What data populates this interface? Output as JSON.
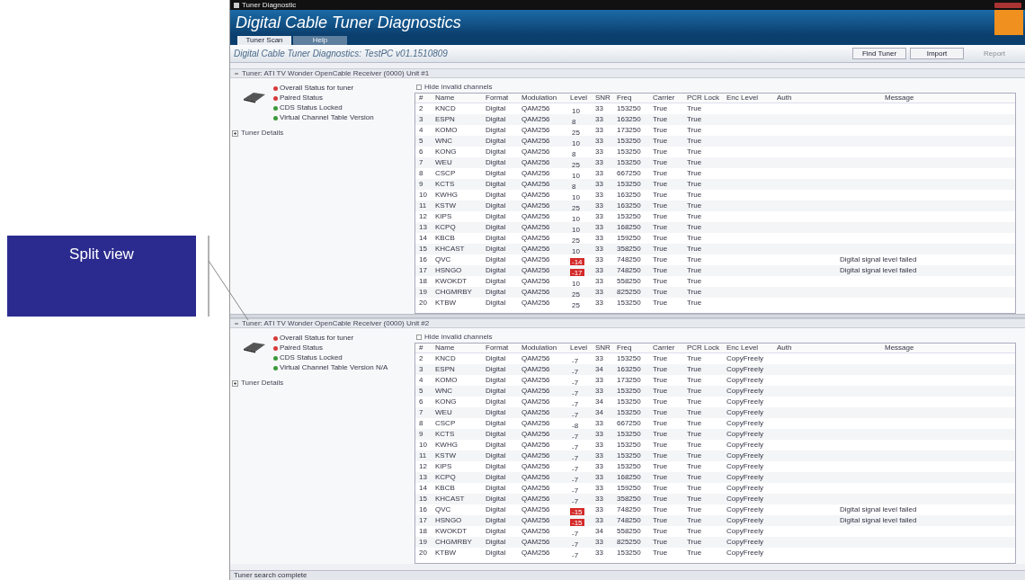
{
  "callout": {
    "label": "Split view"
  },
  "window": {
    "title": "Tuner Diagnostic"
  },
  "header": {
    "title": "Digital Cable Tuner Diagnostics"
  },
  "tabs": [
    {
      "label": "Tuner Scan",
      "selected": true
    },
    {
      "label": "Help",
      "selected": false
    }
  ],
  "toolbar": {
    "title": "Digital Cable Tuner Diagnostics: TestPC v01.1510809",
    "buttons": [
      {
        "label": "Find Tuner",
        "disabled": false
      },
      {
        "label": "Import",
        "disabled": false
      },
      {
        "label": "Report",
        "disabled": true
      }
    ]
  },
  "panels": [
    {
      "header": "Tuner: ATI TV Wonder OpenCable Receiver (0000) Unit #1",
      "expanded": true,
      "statuses": [
        {
          "label": "Overall Status for tuner",
          "color": "#d63a3a"
        },
        {
          "label": "Paired Status",
          "color": "#d63a3a"
        },
        {
          "label": "CDS Status Locked",
          "color": "#3a9a3a"
        },
        {
          "label": "Virtual Channel Table Version",
          "color": "#3a9a3a"
        }
      ],
      "details": {
        "label": "Tuner Details",
        "expanded": false
      },
      "hide_invalid": {
        "label": "Hide invalid channels",
        "checked": false
      },
      "columns": [
        "#",
        "Name",
        "Format",
        "Modulation",
        "Level",
        "SNR",
        "Freq",
        "Carrier",
        "PCR Lock",
        "Enc Level",
        "Auth",
        "Message"
      ],
      "rows": [
        {
          "num": "2",
          "name": "KNCD",
          "format": "Digital",
          "modulation": "QAM256",
          "level": "10",
          "level_alert": false,
          "snr": "33",
          "freq": "153250",
          "carrier": "True",
          "pcr_lock": "True"
        },
        {
          "num": "3",
          "name": "ESPN",
          "format": "Digital",
          "modulation": "QAM256",
          "level": "8",
          "level_alert": false,
          "snr": "33",
          "freq": "163250",
          "carrier": "True",
          "pcr_lock": "True"
        },
        {
          "num": "4",
          "name": "KOMO",
          "format": "Digital",
          "modulation": "QAM256",
          "level": "25",
          "level_alert": false,
          "snr": "33",
          "freq": "173250",
          "carrier": "True",
          "pcr_lock": "True"
        },
        {
          "num": "5",
          "name": "WNC",
          "format": "Digital",
          "modulation": "QAM256",
          "level": "10",
          "level_alert": false,
          "snr": "33",
          "freq": "153250",
          "carrier": "True",
          "pcr_lock": "True"
        },
        {
          "num": "6",
          "name": "KONG",
          "format": "Digital",
          "modulation": "QAM256",
          "level": "8",
          "level_alert": false,
          "snr": "33",
          "freq": "153250",
          "carrier": "True",
          "pcr_lock": "True"
        },
        {
          "num": "7",
          "name": "WEU",
          "format": "Digital",
          "modulation": "QAM256",
          "level": "25",
          "level_alert": false,
          "snr": "33",
          "freq": "153250",
          "carrier": "True",
          "pcr_lock": "True"
        },
        {
          "num": "8",
          "name": "CSCP",
          "format": "Digital",
          "modulation": "QAM256",
          "level": "10",
          "level_alert": false,
          "snr": "33",
          "freq": "667250",
          "carrier": "True",
          "pcr_lock": "True"
        },
        {
          "num": "9",
          "name": "KCTS",
          "format": "Digital",
          "modulation": "QAM256",
          "level": "8",
          "level_alert": false,
          "snr": "33",
          "freq": "153250",
          "carrier": "True",
          "pcr_lock": "True"
        },
        {
          "num": "10",
          "name": "KWHG",
          "format": "Digital",
          "modulation": "QAM256",
          "level": "10",
          "level_alert": false,
          "snr": "33",
          "freq": "163250",
          "carrier": "True",
          "pcr_lock": "True"
        },
        {
          "num": "11",
          "name": "KSTW",
          "format": "Digital",
          "modulation": "QAM256",
          "level": "25",
          "level_alert": false,
          "snr": "33",
          "freq": "163250",
          "carrier": "True",
          "pcr_lock": "True"
        },
        {
          "num": "12",
          "name": "KIPS",
          "format": "Digital",
          "modulation": "QAM256",
          "level": "10",
          "level_alert": false,
          "snr": "33",
          "freq": "153250",
          "carrier": "True",
          "pcr_lock": "True"
        },
        {
          "num": "13",
          "name": "KCPQ",
          "format": "Digital",
          "modulation": "QAM256",
          "level": "10",
          "level_alert": false,
          "snr": "33",
          "freq": "168250",
          "carrier": "True",
          "pcr_lock": "True"
        },
        {
          "num": "14",
          "name": "KBCB",
          "format": "Digital",
          "modulation": "QAM256",
          "level": "25",
          "level_alert": false,
          "snr": "33",
          "freq": "159250",
          "carrier": "True",
          "pcr_lock": "True"
        },
        {
          "num": "15",
          "name": "KHCAST",
          "format": "Digital",
          "modulation": "QAM256",
          "level": "10",
          "level_alert": false,
          "snr": "33",
          "freq": "358250",
          "carrier": "True",
          "pcr_lock": "True"
        },
        {
          "num": "16",
          "name": "QVC",
          "format": "Digital",
          "modulation": "QAM256",
          "level": "-14",
          "level_alert": true,
          "snr": "33",
          "freq": "748250",
          "carrier": "True",
          "pcr_lock": "True",
          "message": "Digital signal level failed"
        },
        {
          "num": "17",
          "name": "HSNGO",
          "format": "Digital",
          "modulation": "QAM256",
          "level": "-17",
          "level_alert": true,
          "snr": "33",
          "freq": "748250",
          "carrier": "True",
          "pcr_lock": "True",
          "message": "Digital signal level failed"
        },
        {
          "num": "18",
          "name": "KWOKDT",
          "format": "Digital",
          "modulation": "QAM256",
          "level": "10",
          "level_alert": false,
          "snr": "33",
          "freq": "558250",
          "carrier": "True",
          "pcr_lock": "True"
        },
        {
          "num": "19",
          "name": "CHGMRBY",
          "format": "Digital",
          "modulation": "QAM256",
          "level": "25",
          "level_alert": false,
          "snr": "33",
          "freq": "825250",
          "carrier": "True",
          "pcr_lock": "True"
        },
        {
          "num": "20",
          "name": "KTBW",
          "format": "Digital",
          "modulation": "QAM256",
          "level": "25",
          "level_alert": false,
          "snr": "33",
          "freq": "153250",
          "carrier": "True",
          "pcr_lock": "True"
        }
      ]
    },
    {
      "header": "Tuner: ATI TV Wonder OpenCable Receiver (0000) Unit #2",
      "expanded": true,
      "statuses": [
        {
          "label": "Overall Status for tuner",
          "color": "#d63a3a"
        },
        {
          "label": "Paired Status",
          "color": "#d63a3a"
        },
        {
          "label": "CDS Status Locked",
          "color": "#3a9a3a"
        },
        {
          "label": "Virtual Channel Table Version N/A",
          "color": "#3a9a3a"
        }
      ],
      "details": {
        "label": "Tuner Details",
        "expanded": false
      },
      "hide_invalid": {
        "label": "Hide invalid channels",
        "checked": false
      },
      "columns": [
        "#",
        "Name",
        "Format",
        "Modulation",
        "Level",
        "SNR",
        "Freq",
        "Carrier",
        "PCR Lock",
        "Enc Level",
        "Auth",
        "Message"
      ],
      "rows": [
        {
          "num": "2",
          "name": "KNCD",
          "format": "Digital",
          "modulation": "QAM256",
          "level": "-7",
          "level_alert": false,
          "snr": "33",
          "freq": "153250",
          "carrier": "True",
          "pcr_lock": "True",
          "enc_level": "CopyFreely"
        },
        {
          "num": "3",
          "name": "ESPN",
          "format": "Digital",
          "modulation": "QAM256",
          "level": "-7",
          "level_alert": false,
          "snr": "34",
          "freq": "163250",
          "carrier": "True",
          "pcr_lock": "True",
          "enc_level": "CopyFreely"
        },
        {
          "num": "4",
          "name": "KOMO",
          "format": "Digital",
          "modulation": "QAM256",
          "level": "-7",
          "level_alert": false,
          "snr": "33",
          "freq": "173250",
          "carrier": "True",
          "pcr_lock": "True",
          "enc_level": "CopyFreely"
        },
        {
          "num": "5",
          "name": "WNC",
          "format": "Digital",
          "modulation": "QAM256",
          "level": "-7",
          "level_alert": false,
          "snr": "33",
          "freq": "153250",
          "carrier": "True",
          "pcr_lock": "True",
          "enc_level": "CopyFreely"
        },
        {
          "num": "6",
          "name": "KONG",
          "format": "Digital",
          "modulation": "QAM256",
          "level": "-7",
          "level_alert": false,
          "snr": "34",
          "freq": "153250",
          "carrier": "True",
          "pcr_lock": "True",
          "enc_level": "CopyFreely"
        },
        {
          "num": "7",
          "name": "WEU",
          "format": "Digital",
          "modulation": "QAM256",
          "level": "-7",
          "level_alert": false,
          "snr": "34",
          "freq": "153250",
          "carrier": "True",
          "pcr_lock": "True",
          "enc_level": "CopyFreely"
        },
        {
          "num": "8",
          "name": "CSCP",
          "format": "Digital",
          "modulation": "QAM256",
          "level": "-8",
          "level_alert": false,
          "snr": "33",
          "freq": "667250",
          "carrier": "True",
          "pcr_lock": "True",
          "enc_level": "CopyFreely"
        },
        {
          "num": "9",
          "name": "KCTS",
          "format": "Digital",
          "modulation": "QAM256",
          "level": "-7",
          "level_alert": false,
          "snr": "33",
          "freq": "153250",
          "carrier": "True",
          "pcr_lock": "True",
          "enc_level": "CopyFreely"
        },
        {
          "num": "10",
          "name": "KWHG",
          "format": "Digital",
          "modulation": "QAM256",
          "level": "-7",
          "level_alert": false,
          "snr": "33",
          "freq": "153250",
          "carrier": "True",
          "pcr_lock": "True",
          "enc_level": "CopyFreely"
        },
        {
          "num": "11",
          "name": "KSTW",
          "format": "Digital",
          "modulation": "QAM256",
          "level": "-7",
          "level_alert": false,
          "snr": "33",
          "freq": "153250",
          "carrier": "True",
          "pcr_lock": "True",
          "enc_level": "CopyFreely"
        },
        {
          "num": "12",
          "name": "KIPS",
          "format": "Digital",
          "modulation": "QAM256",
          "level": "-7",
          "level_alert": false,
          "snr": "33",
          "freq": "153250",
          "carrier": "True",
          "pcr_lock": "True",
          "enc_level": "CopyFreely"
        },
        {
          "num": "13",
          "name": "KCPQ",
          "format": "Digital",
          "modulation": "QAM256",
          "level": "-7",
          "level_alert": false,
          "snr": "33",
          "freq": "168250",
          "carrier": "True",
          "pcr_lock": "True",
          "enc_level": "CopyFreely"
        },
        {
          "num": "14",
          "name": "KBCB",
          "format": "Digital",
          "modulation": "QAM256",
          "level": "-7",
          "level_alert": false,
          "snr": "33",
          "freq": "159250",
          "carrier": "True",
          "pcr_lock": "True",
          "enc_level": "CopyFreely"
        },
        {
          "num": "15",
          "name": "KHCAST",
          "format": "Digital",
          "modulation": "QAM256",
          "level": "-7",
          "level_alert": false,
          "snr": "33",
          "freq": "358250",
          "carrier": "True",
          "pcr_lock": "True",
          "enc_level": "CopyFreely"
        },
        {
          "num": "16",
          "name": "QVC",
          "format": "Digital",
          "modulation": "QAM256",
          "level": "-15",
          "level_alert": true,
          "snr": "33",
          "freq": "748250",
          "carrier": "True",
          "pcr_lock": "True",
          "enc_level": "CopyFreely",
          "message": "Digital signal level failed"
        },
        {
          "num": "17",
          "name": "HSNGO",
          "format": "Digital",
          "modulation": "QAM256",
          "level": "-15",
          "level_alert": true,
          "snr": "33",
          "freq": "748250",
          "carrier": "True",
          "pcr_lock": "True",
          "enc_level": "CopyFreely",
          "message": "Digital signal level failed"
        },
        {
          "num": "18",
          "name": "KWOKDT",
          "format": "Digital",
          "modulation": "QAM256",
          "level": "-7",
          "level_alert": false,
          "snr": "34",
          "freq": "558250",
          "carrier": "True",
          "pcr_lock": "True",
          "enc_level": "CopyFreely"
        },
        {
          "num": "19",
          "name": "CHGMRBY",
          "format": "Digital",
          "modulation": "QAM256",
          "level": "-7",
          "level_alert": false,
          "snr": "33",
          "freq": "825250",
          "carrier": "True",
          "pcr_lock": "True",
          "enc_level": "CopyFreely"
        },
        {
          "num": "20",
          "name": "KTBW",
          "format": "Digital",
          "modulation": "QAM256",
          "level": "-7",
          "level_alert": false,
          "snr": "33",
          "freq": "153250",
          "carrier": "True",
          "pcr_lock": "True",
          "enc_level": "CopyFreely"
        }
      ]
    }
  ],
  "status_bar": "Tuner search complete"
}
